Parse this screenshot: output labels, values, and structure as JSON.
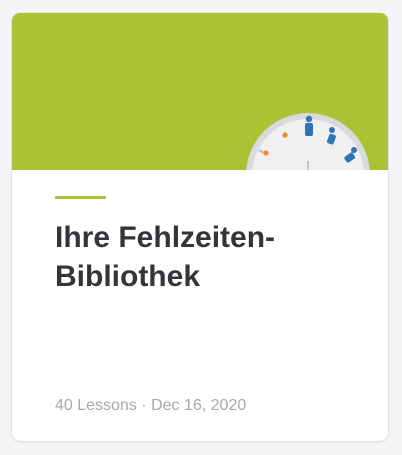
{
  "card": {
    "title": "Ihre Fehlzeiten-\nBibliothek",
    "lessons": "40 Lessons",
    "separator": " · ",
    "date": "Dec 16, 2020",
    "accent_color": "#acc235",
    "cover_color": "#acc235",
    "cover_icon": "clock-icon"
  }
}
